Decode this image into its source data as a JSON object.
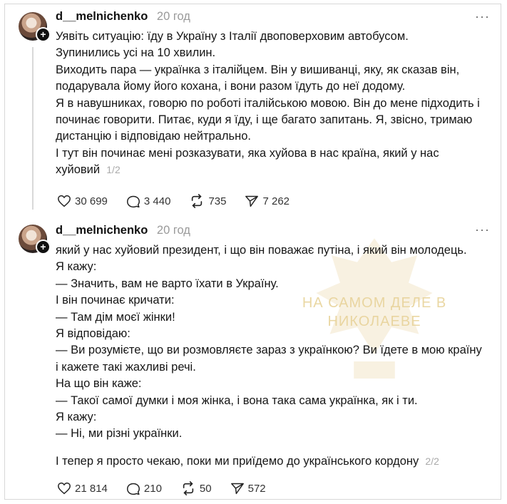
{
  "posts": [
    {
      "username": "d__melnichenko",
      "time": "20 год",
      "lines": [
        "Уявіть ситуацію: їду в Україну з Італії двоповерховим автобусом.",
        "Зупинились усі на 10 хвилин.",
        "Виходить пара — українка з італійцем. Він у вишиванці, яку, як сказав він,",
        "подарувала йому його кохана, і вони разом їдуть до неї додому.",
        "Я в навушниках, говорю по роботі італійською мовою. Він до мене підходить і",
        "починає говорити. Питає, куди я їду, і ще багато запитань. Я, звісно, тримаю",
        "дистанцію і відповідаю нейтрально.",
        "І тут він починає мені розказувати, яка хуйова в нас країна, який у нас",
        "хуйовий"
      ],
      "page_indicator": "1/2",
      "likes": "30 699",
      "comments": "3 440",
      "reposts": "735",
      "shares": "7 262"
    },
    {
      "username": "d__melnichenko",
      "time": "20 год",
      "lines": [
        "який у нас хуйовий президент, і що він поважає путіна, і який він молодець.",
        "Я кажу:",
        "— Значить, вам не варто їхати в Україну.",
        "І він починає кричати:",
        "— Там дім моєї жінки!",
        "Я відповідаю:",
        "— Ви розумієте, що ви розмовляєте зараз з українкою? Ви їдете в мою країну",
        "і кажете такі жахливі речі.",
        "На що він каже:",
        "— Такої самої думки і моя жінка, і вона така сама українка, як і ти.",
        "Я кажу:",
        "— Ні, ми різні українки.",
        "",
        "І тепер я просто чекаю, поки ми приїдемо до українського кордону"
      ],
      "page_indicator": "2/2",
      "likes": "21 814",
      "comments": "210",
      "reposts": "50",
      "shares": "572"
    }
  ],
  "watermark": {
    "line1": "НА САМОМ ДЕЛЕ В",
    "line2": "НИКОЛАЕВЕ"
  },
  "icons": {
    "more": "more-horizontal-icon",
    "like": "heart-icon",
    "comment": "comment-bubble-icon",
    "repost": "repost-icon",
    "share": "send-icon",
    "follow": "plus-icon"
  },
  "colors": {
    "muted": "#9a9a9a",
    "text": "#161616"
  }
}
